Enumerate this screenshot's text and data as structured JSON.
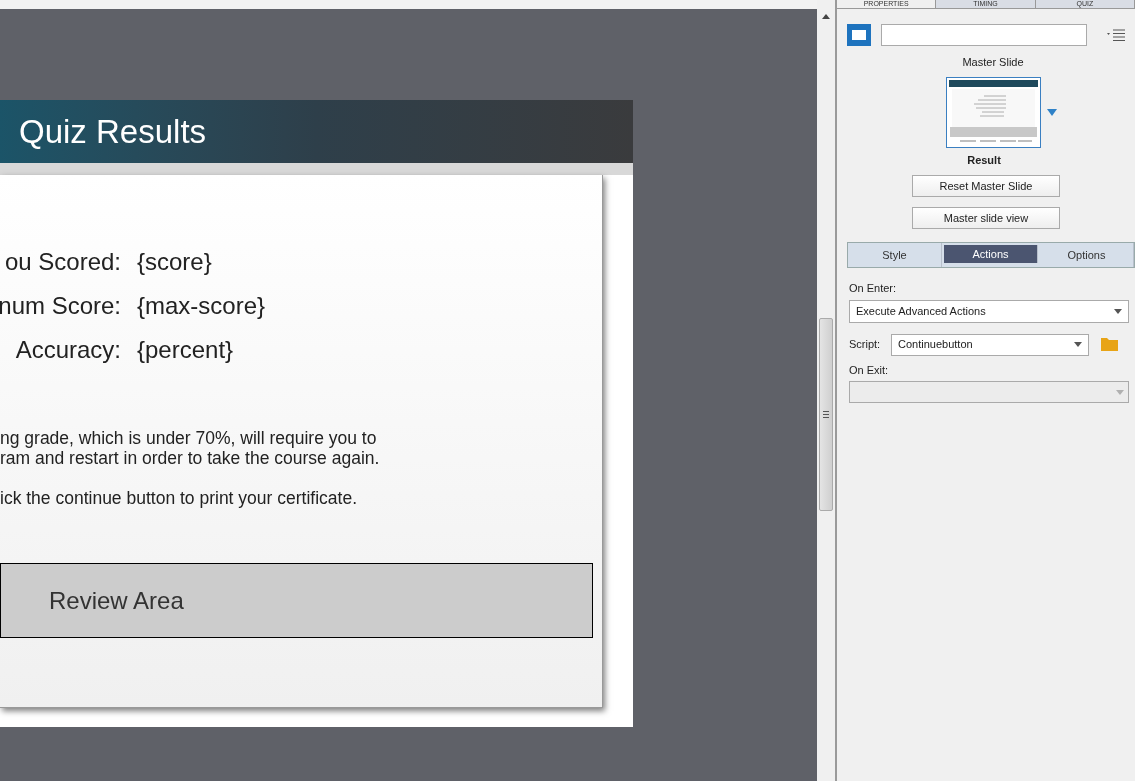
{
  "slide": {
    "title": "Quiz Results",
    "results": [
      {
        "label": "ou Scored:",
        "value": "{score}"
      },
      {
        "label": "num Score:",
        "value": "{max-score}"
      },
      {
        "label": "Accuracy:",
        "value": "{percent}"
      }
    ],
    "message_lines": [
      "ng grade, which is under 70%, will require you to",
      "ram and restart in order to take the course again."
    ],
    "note": "ick the continue button to print your certificate.",
    "review_area": "Review Area"
  },
  "panel": {
    "tabs": [
      {
        "label": "PROPERTIES",
        "selected": true
      },
      {
        "label": "TIMING",
        "selected": false
      },
      {
        "label": "QUIZ",
        "selected": false
      }
    ],
    "master_slide": {
      "heading": "Master Slide",
      "name": "Result"
    },
    "buttons": [
      "Reset Master Slide",
      "Master slide view"
    ],
    "subtabs": [
      {
        "label": "Style",
        "selected": false
      },
      {
        "label": "Actions",
        "selected": true
      },
      {
        "label": "Options",
        "selected": false
      }
    ],
    "on_enter": {
      "label": "On Enter:",
      "value": "Execute Advanced Actions"
    },
    "script": {
      "label": "Script:",
      "value": "Continuebutton"
    },
    "on_exit": {
      "label": "On Exit:",
      "disabled": true
    }
  }
}
